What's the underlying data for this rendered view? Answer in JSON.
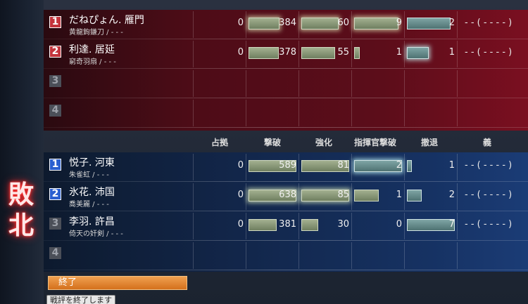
{
  "result_label": "敗北",
  "headers": [
    "占拠",
    "撃破",
    "強化",
    "指揮官撃破",
    "撤退",
    "義"
  ],
  "team_red": [
    {
      "rank": "1",
      "name": "だねぴょん. 雁門",
      "weapon": "黄龍鉤鎌刀 / - - -",
      "occupy": "0",
      "kills": "384",
      "kills_fill": 0.64,
      "kills_glow": true,
      "boost": "60",
      "boost_fill": 0.77,
      "boost_glow": true,
      "cmdr": "9",
      "cmdr_fill": 0.92,
      "cmdr_glow": true,
      "retreat": "2",
      "retreat_fill": 0.9,
      "retreat_glow": false,
      "gi": "- - ( - - - - )"
    },
    {
      "rank": "2",
      "name": "利達. 居延",
      "weapon": "窮奇羽扇 / - - -",
      "occupy": "0",
      "kills": "378",
      "kills_fill": 0.63,
      "kills_glow": false,
      "boost": "55",
      "boost_fill": 0.7,
      "boost_glow": false,
      "cmdr": "1",
      "cmdr_fill": 0.11,
      "cmdr_glow": false,
      "retreat": "1",
      "retreat_fill": 0.45,
      "retreat_glow": true,
      "gi": "- - ( - - - - )"
    },
    {
      "rank": "3",
      "name": "",
      "weapon": "",
      "occupy": "",
      "kills": "",
      "boost": "",
      "cmdr": "",
      "retreat": "",
      "gi": ""
    },
    {
      "rank": "4",
      "name": "",
      "weapon": "",
      "occupy": "",
      "kills": "",
      "boost": "",
      "cmdr": "",
      "retreat": "",
      "gi": ""
    }
  ],
  "team_blue": [
    {
      "rank": "1",
      "name": "悦子. 河東",
      "weapon": "朱雀虹 / - - -",
      "occupy": "0",
      "kills": "589",
      "kills_fill": 0.98,
      "kills_glow": false,
      "boost": "81",
      "boost_fill": 0.98,
      "boost_glow": false,
      "cmdr": "2",
      "cmdr_fill": 0.98,
      "cmdr_glow": true,
      "retreat": "1",
      "retreat_fill": 0.1,
      "retreat_glow": false,
      "gi": "- - ( - - - - )"
    },
    {
      "rank": "2",
      "name": "氷花. 沛国",
      "weapon": "喬美麗 / - - -",
      "occupy": "0",
      "kills": "638",
      "kills_fill": 0.98,
      "kills_glow": true,
      "boost": "85",
      "boost_fill": 0.98,
      "boost_glow": true,
      "cmdr": "1",
      "cmdr_fill": 0.5,
      "cmdr_glow": false,
      "retreat": "2",
      "retreat_fill": 0.3,
      "retreat_glow": false,
      "gi": "- - ( - - - - )"
    },
    {
      "rank": "3",
      "name": "李羽. 許昌",
      "weapon": "倚天の奸剣 / - - -",
      "occupy": "0",
      "kills": "381",
      "kills_fill": 0.58,
      "kills_glow": false,
      "boost": "30",
      "boost_fill": 0.35,
      "boost_glow": false,
      "cmdr": "0",
      "cmdr_fill": 0,
      "cmdr_glow": false,
      "retreat": "7",
      "retreat_fill": 0.98,
      "retreat_glow": false,
      "gi": "- - ( - - - - )"
    },
    {
      "rank": "4",
      "name": "",
      "weapon": "",
      "occupy": "",
      "kills": "",
      "boost": "",
      "cmdr": "",
      "retreat": "",
      "gi": ""
    }
  ],
  "footer": {
    "end_label": "終了",
    "tooltip": "戦評を終了します"
  }
}
